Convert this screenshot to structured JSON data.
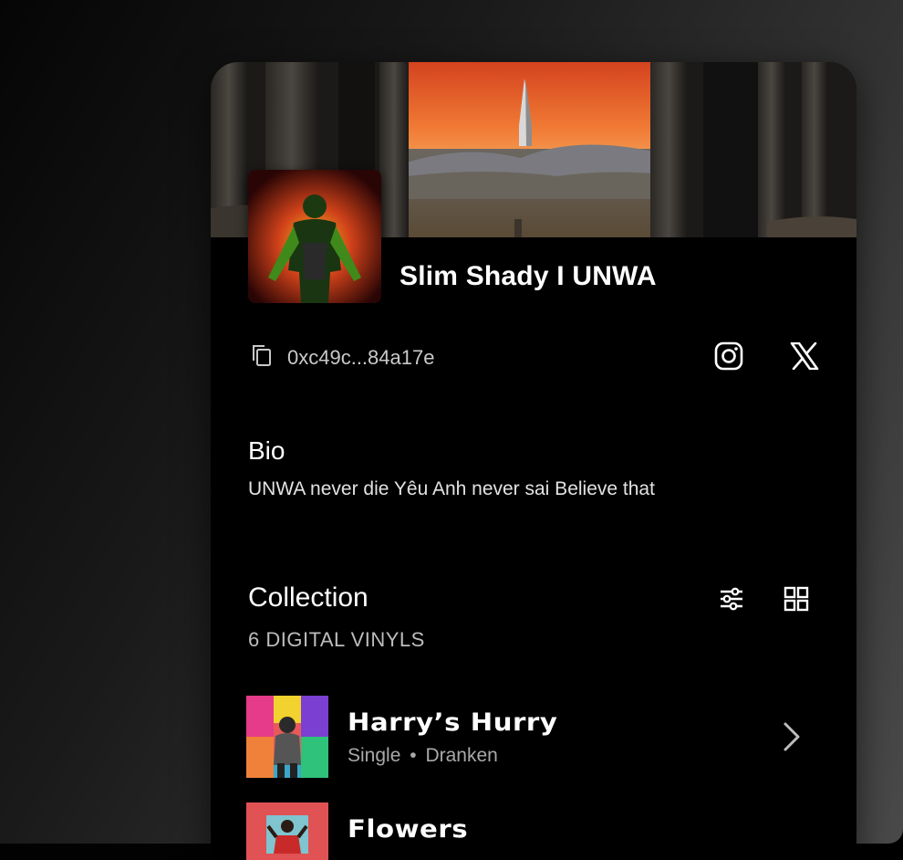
{
  "profile": {
    "name": "Slim Shady I UNWA",
    "wallet": "0xc49c...84a17e"
  },
  "socials": {
    "instagram_icon": "instagram-icon",
    "x_icon": "x-logo-icon"
  },
  "bio": {
    "title": "Bio",
    "text": "UNWA never die Yêu Anh never sai Believe that"
  },
  "collection": {
    "title": "Collection",
    "count": "6 DIGITAL VINYLS",
    "items": [
      {
        "title": "Harry’s Hurry",
        "type": "Single",
        "separator": "•",
        "artist": "Dranken"
      },
      {
        "title": "Flowers",
        "type": "",
        "separator": "",
        "artist": ""
      }
    ]
  },
  "colors": {
    "background": "#000000",
    "text_primary": "#ffffff",
    "text_secondary": "#a9a9a9",
    "banner_sky": "#e5512a"
  }
}
